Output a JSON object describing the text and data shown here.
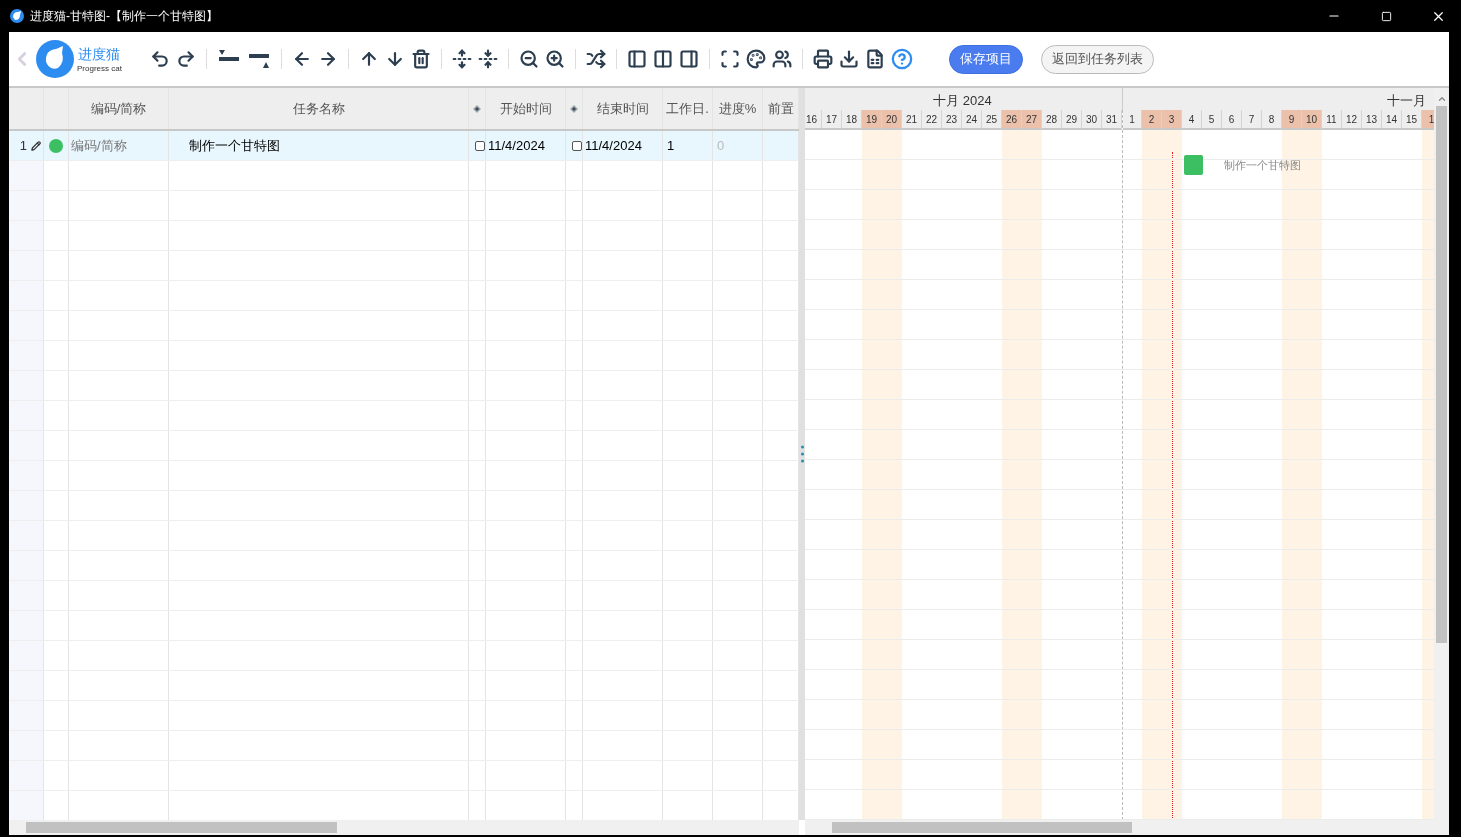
{
  "window": {
    "title": "进度猫-甘特图-【制作一个甘特图】"
  },
  "logo": {
    "name": "进度猫",
    "tagline": "Progress cat"
  },
  "toolbar": {
    "buttons": [
      {
        "label": "保存项目",
        "kind": "primary"
      },
      {
        "label": "返回到任务列表",
        "kind": "secondary"
      }
    ]
  },
  "task_grid": {
    "columns": [
      {
        "kind": "blank"
      },
      {
        "kind": "blank"
      },
      {
        "kind": "text",
        "label": "编码/简称"
      },
      {
        "kind": "text",
        "label": "任务名称"
      },
      {
        "kind": "diamond"
      },
      {
        "kind": "text",
        "label": "开始时间"
      },
      {
        "kind": "diamond"
      },
      {
        "kind": "text",
        "label": "结束时间"
      },
      {
        "kind": "text",
        "label": "工作日."
      },
      {
        "kind": "text",
        "label": "进度%"
      },
      {
        "kind": "text",
        "label": "前置"
      }
    ],
    "rows": [
      {
        "number": "1",
        "color": "#3cbf63",
        "code": "编码/简称",
        "name": "制作一个甘特图",
        "start": "11/4/2024",
        "start_checked": false,
        "end": "11/4/2024",
        "end_checked": false,
        "workdays": "1",
        "progress": "0",
        "selected": true
      }
    ]
  },
  "gantt": {
    "months": [
      {
        "label": "十月 2024",
        "days": [
          {
            "day": "16",
            "weekend": false
          },
          {
            "day": "17",
            "weekend": false
          },
          {
            "day": "18",
            "weekend": false
          },
          {
            "day": "19",
            "weekend": true
          },
          {
            "day": "20",
            "weekend": true
          },
          {
            "day": "21",
            "weekend": false
          },
          {
            "day": "22",
            "weekend": false
          },
          {
            "day": "23",
            "weekend": false
          },
          {
            "day": "24",
            "weekend": false
          },
          {
            "day": "25",
            "weekend": false
          },
          {
            "day": "26",
            "weekend": true
          },
          {
            "day": "27",
            "weekend": true
          },
          {
            "day": "28",
            "weekend": false
          },
          {
            "day": "29",
            "weekend": false
          },
          {
            "day": "30",
            "weekend": false
          },
          {
            "day": "31",
            "weekend": false
          }
        ]
      },
      {
        "label": "十一月",
        "days": [
          {
            "day": "1",
            "weekend": false
          },
          {
            "day": "2",
            "weekend": true
          },
          {
            "day": "3",
            "weekend": true,
            "today": true
          },
          {
            "day": "4",
            "weekend": false,
            "task": "制作一个甘特图"
          },
          {
            "day": "5",
            "weekend": false
          },
          {
            "day": "6",
            "weekend": false
          },
          {
            "day": "7",
            "weekend": false
          },
          {
            "day": "8",
            "weekend": false
          },
          {
            "day": "9",
            "weekend": true
          },
          {
            "day": "10",
            "weekend": true
          },
          {
            "day": "11",
            "weekend": false
          },
          {
            "day": "12",
            "weekend": false
          },
          {
            "day": "13",
            "weekend": false
          },
          {
            "day": "14",
            "weekend": false
          },
          {
            "day": "15",
            "weekend": false
          },
          {
            "day": "1",
            "weekend": true
          }
        ]
      }
    ]
  }
}
